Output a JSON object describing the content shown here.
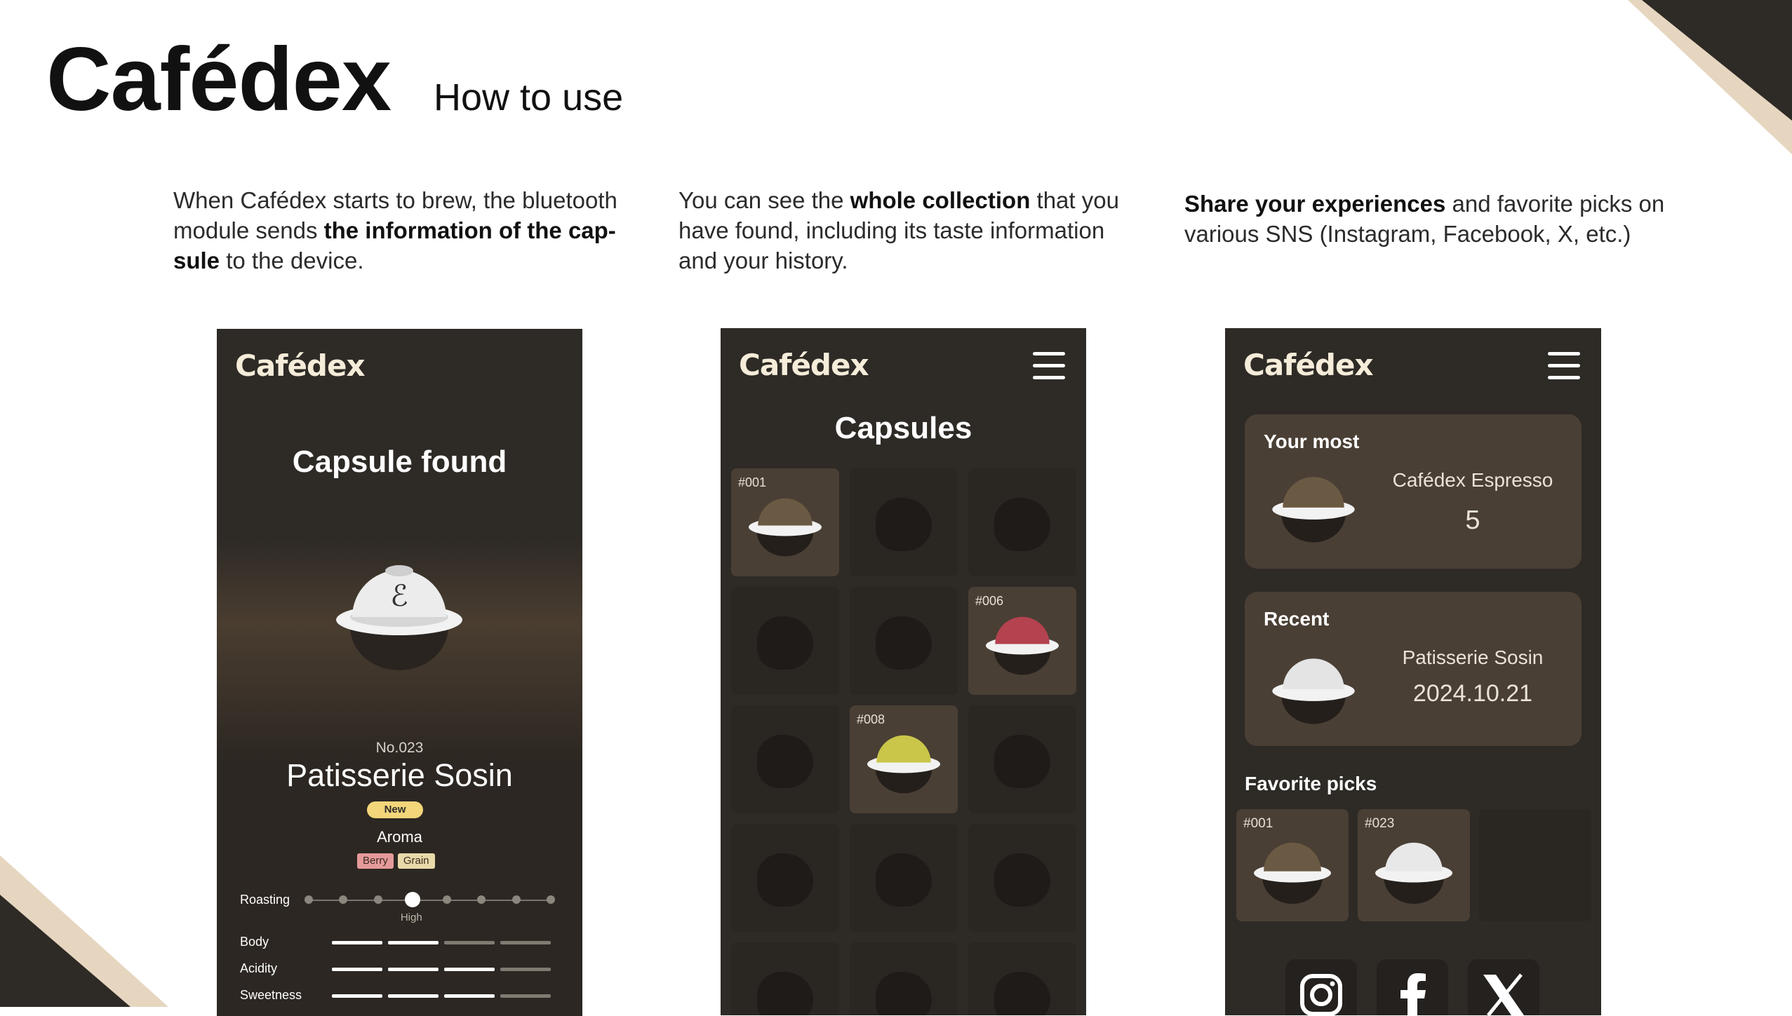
{
  "header": {
    "brand": "Cafédex",
    "subtitle": "How to use"
  },
  "descriptions": [
    {
      "pre": "When Cafédex starts to brew, the bluetooth module sends ",
      "bold": "the information of the cap-sule",
      "post": " to the device."
    },
    {
      "pre": "You can see the ",
      "bold": "whole collection",
      "post": " that you have found, including its taste information and your history."
    },
    {
      "pre": "",
      "bold": "Share your experiences",
      "post": " and favorite picks on various SNS (Instagram, Facebook, X, etc.)"
    }
  ],
  "app_logo": "Cafédex",
  "phone1": {
    "title": "Capsule found",
    "number": "No.023",
    "name": "Patisserie Sosin",
    "badge": "New",
    "aroma_label": "Aroma",
    "aroma_tags": [
      "Berry",
      "Grain"
    ],
    "roasting_label": "Roasting",
    "roasting_value": "High",
    "roasting_level": 4,
    "roasting_steps": 8,
    "attributes": [
      {
        "label": "Body",
        "level": 2,
        "max": 4
      },
      {
        "label": "Acidity",
        "level": 3,
        "max": 4
      },
      {
        "label": "Sweetness",
        "level": 3,
        "max": 4
      }
    ],
    "colors": {
      "badge": "#f3d57a",
      "berry": "#e59a9a",
      "grain": "#ead9a9"
    }
  },
  "phone2": {
    "title": "Capsules",
    "cells": [
      {
        "id": "#001",
        "found": true,
        "color": "#6b5a43"
      },
      {
        "found": false
      },
      {
        "found": false
      },
      {
        "found": false
      },
      {
        "found": false
      },
      {
        "id": "#006",
        "found": true,
        "color": "#b4424f"
      },
      {
        "found": false
      },
      {
        "id": "#008",
        "found": true,
        "color": "#c9c64a"
      },
      {
        "found": false
      },
      {
        "found": false
      },
      {
        "found": false
      },
      {
        "found": false
      },
      {
        "found": false
      },
      {
        "found": false
      },
      {
        "found": false
      }
    ]
  },
  "phone3": {
    "most": {
      "heading": "Your most",
      "name": "Cafédex Espresso",
      "count": "5"
    },
    "recent": {
      "heading": "Recent",
      "name": "Patisserie Sosin",
      "date": "2024.10.21"
    },
    "favorites_heading": "Favorite picks",
    "favorites": [
      {
        "id": "#001",
        "color": "#6b5a43"
      },
      {
        "id": "#023",
        "color": "#e8e8e8"
      },
      {
        "id": "",
        "color": ""
      }
    ],
    "sns": [
      "instagram-icon",
      "facebook-icon",
      "x-icon"
    ]
  }
}
